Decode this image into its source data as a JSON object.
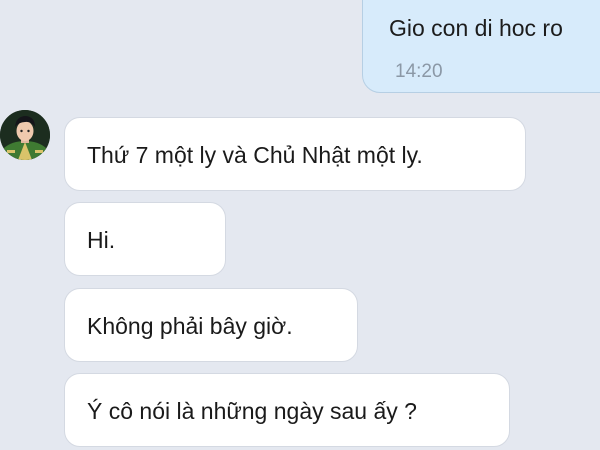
{
  "outgoing": {
    "text": "Gio con di hoc ro",
    "time": "14:20"
  },
  "contact": {
    "avatar_icon": "officer-avatar-icon"
  },
  "messages": [
    {
      "text": "Thứ 7 một ly và Chủ Nhật một ly."
    },
    {
      "text": "Hi."
    },
    {
      "text": "Không phải bây giờ."
    },
    {
      "text": "Ý cô nói là những ngày sau ấy ?"
    }
  ],
  "colors": {
    "background": "#e4e8f0",
    "outgoing_bubble": "#d7ebfb",
    "incoming_bubble": "#ffffff",
    "timestamp": "#8b98a6"
  }
}
